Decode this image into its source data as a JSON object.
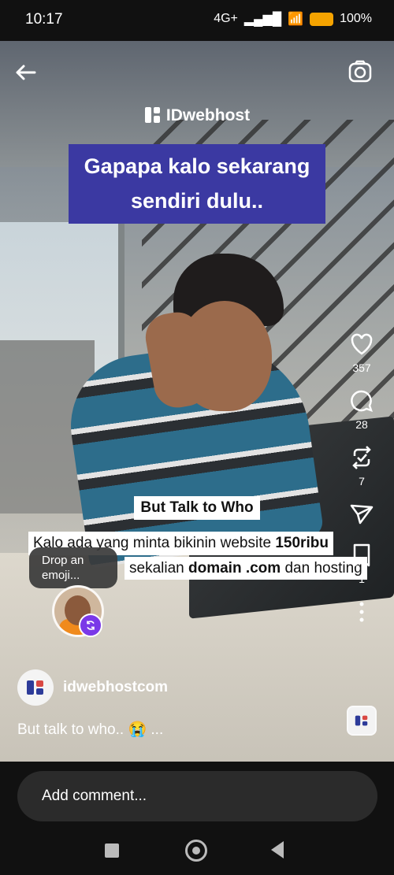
{
  "status_bar": {
    "time": "10:17",
    "network": "4G+",
    "battery": "100%"
  },
  "video": {
    "brand": "IDwebhost",
    "caption_top_line1": "Gapapa kalo sekarang",
    "caption_top_line2": "sendiri dulu..",
    "caption_mid": "But Talk to Who",
    "caption_bottom_line1_prefix": "Kalo ada yang minta bikinin website ",
    "caption_bottom_line1_bold": "150ribu",
    "caption_bottom_line2_prefix": "sekalian ",
    "caption_bottom_line2_bold": "domain .com",
    "caption_bottom_line2_suffix": " dan hosting"
  },
  "emoji_prompt": {
    "label": "Drop an emoji..."
  },
  "actions": {
    "likes": "357",
    "comments": "28",
    "reposts": "7",
    "saves": "1",
    "icons": [
      "heart-icon",
      "comment-icon",
      "repost-icon",
      "share-icon",
      "bookmark-icon",
      "more-vertical-icon"
    ]
  },
  "post": {
    "username": "idwebhostcom",
    "caption": "But talk to who.. 😭 ..."
  },
  "comment_box": {
    "placeholder": "Add comment..."
  },
  "colors": {
    "caption_bg": "#3b39a2",
    "brand_red": "#d94843",
    "brand_blue": "#2d3b99",
    "badge_purple": "#7a38e8"
  }
}
